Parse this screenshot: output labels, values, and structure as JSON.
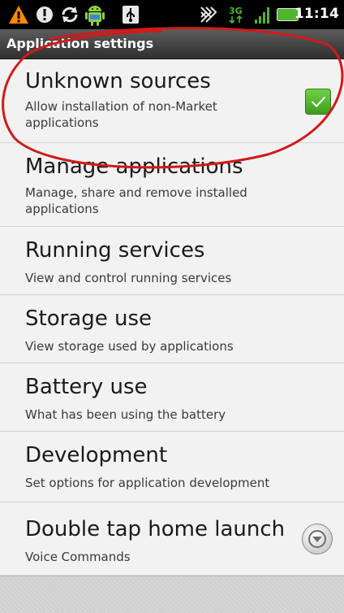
{
  "status_bar": {
    "time": "11:14",
    "network_type": "3G",
    "icons": [
      "warning-icon",
      "info-icon",
      "sync-icon",
      "android-icon",
      "usb-icon",
      "vibrate-icon",
      "network-3g-icon",
      "signal-icon",
      "battery-icon"
    ]
  },
  "title_bar": {
    "title": "Application settings"
  },
  "settings": [
    {
      "title": "Unknown sources",
      "summary": "Allow installation of non-Market applications",
      "control": "checkbox",
      "checked": true
    },
    {
      "title": "Manage applications",
      "summary": "Manage, share and remove installed applications"
    },
    {
      "title": "Running services",
      "summary": "View and control running services"
    },
    {
      "title": "Storage use",
      "summary": "View storage used by applications"
    },
    {
      "title": "Battery use",
      "summary": "What has been using the battery"
    },
    {
      "title": "Development",
      "summary": "Set options for application development"
    },
    {
      "title": "Double tap home launch",
      "summary": "Voice Commands",
      "control": "dropdown"
    }
  ],
  "colors": {
    "checkbox_green": "#4fb52a",
    "annotation_red": "#d11a1a",
    "title_bar": "#3c3c3c",
    "list_background": "#f2f2f2"
  }
}
